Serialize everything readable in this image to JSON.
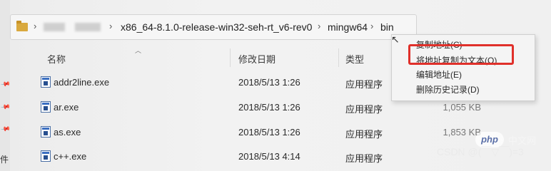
{
  "address": {
    "separator": "›",
    "crumbs": [
      "x86_64-8.1.0-release-win32-seh-rt_v6-rev0",
      "mingw64",
      "bin"
    ]
  },
  "columns": {
    "name": "名称",
    "date": "修改日期",
    "type": "类型"
  },
  "files": [
    {
      "name": "addr2line.exe",
      "date": "2018/5/13 1:26",
      "type": "应用程序",
      "size": ""
    },
    {
      "name": "ar.exe",
      "date": "2018/5/13 1:26",
      "type": "应用程序",
      "size": "1,055 KB"
    },
    {
      "name": "as.exe",
      "date": "2018/5/13 1:26",
      "type": "应用程序",
      "size": "1,853 KB"
    },
    {
      "name": "c++.exe",
      "date": "2018/5/13 4:14",
      "type": "应用程序",
      "size": ""
    }
  ],
  "context_menu": {
    "items": [
      "复制地址(C)",
      "将地址复制为文本(O)",
      "编辑地址(E)",
      "删除历史记录(D)"
    ],
    "highlight_color": "#e0302a"
  },
  "left_pane": {
    "partial_label": "件"
  },
  "watermark": {
    "php": "php",
    "cn": "中文网",
    "csdn": "CSDN @(￣▽￣)=3"
  }
}
